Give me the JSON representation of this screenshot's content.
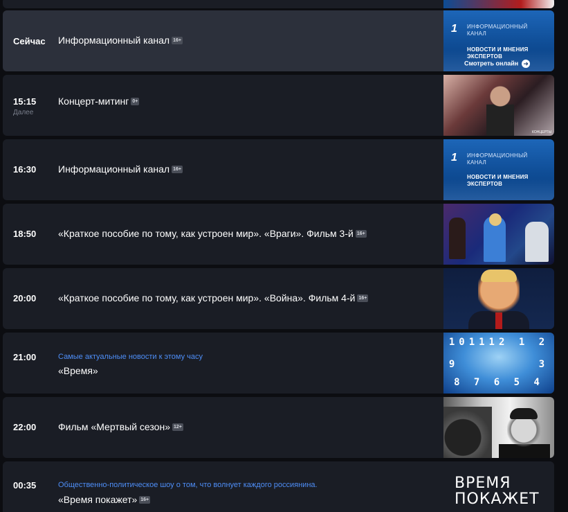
{
  "schedule": [
    {
      "time": "Сейчас",
      "title": "Информационный канал",
      "age": "16+",
      "current": true,
      "thumb": {
        "kind": "info",
        "channel_name_1": "ИНФОРМАЦИОННЫЙ",
        "channel_name_2": "КАНАЛ",
        "tagline_1": "НОВОСТИ И МНЕНИЯ",
        "tagline_2": "ЭКСПЕРТОВ",
        "watch_label": "Смотреть онлайн"
      }
    },
    {
      "time": "15:15",
      "sub_time": "Далее",
      "title": "Концерт-митинг",
      "age": "0+",
      "thumb": {
        "kind": "concert",
        "label": "КОНЦЕРТЫ"
      }
    },
    {
      "time": "16:30",
      "title": "Информационный канал",
      "age": "16+",
      "thumb": {
        "kind": "info",
        "channel_name_1": "ИНФОРМАЦИОННЫЙ",
        "channel_name_2": "КАНАЛ",
        "tagline_1": "НОВОСТИ И МНЕНИЯ",
        "tagline_2": "ЭКСПЕРТОВ"
      }
    },
    {
      "time": "18:50",
      "title": "«Краткое пособие по тому, как устроен мир». «Враги». Фильм 3-й",
      "age": "16+",
      "thumb": {
        "kind": "film3"
      }
    },
    {
      "time": "20:00",
      "title": "«Краткое пособие по тому, как устроен мир». «Война». Фильм 4-й",
      "age": "16+",
      "thumb": {
        "kind": "film4"
      }
    },
    {
      "time": "21:00",
      "description": "Самые актуальные новости к этому часу",
      "title": "«Время»",
      "thumb": {
        "kind": "vremya",
        "digits_top": "101112 1 2",
        "digits_mid": "9        3",
        "digits_bottom": "8 7 6 5 4"
      }
    },
    {
      "time": "22:00",
      "title": "Фильм «Мертвый сезон»",
      "age": "12+",
      "thumb": {
        "kind": "season"
      }
    },
    {
      "time": "00:35",
      "description": "Общественно-политическое шоу о том, что волнует каждого россиянина.",
      "title": "«Время покажет»",
      "age": "16+",
      "thumb": {
        "kind": "vp",
        "line1": "ВРЕМЯ",
        "line2": "ПОКАЖЕТ"
      }
    }
  ]
}
